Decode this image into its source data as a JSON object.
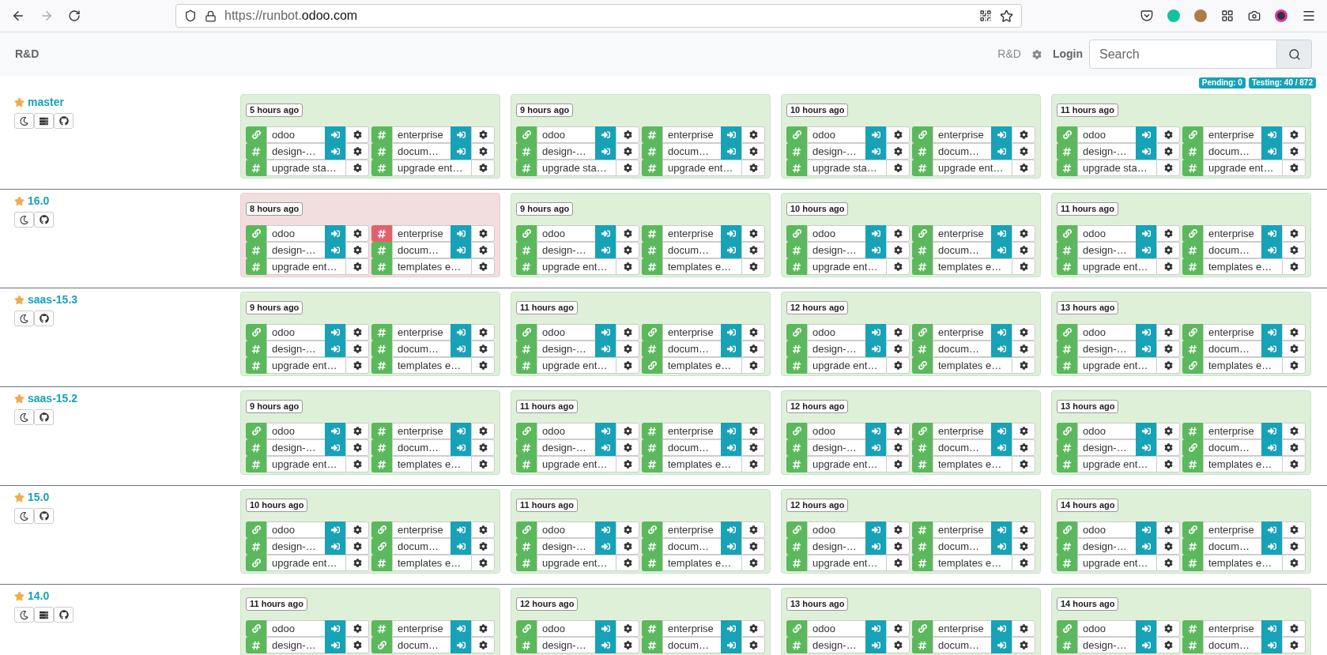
{
  "browser": {
    "url_prefix": "https://runbot.",
    "url_domain": "odoo.com",
    "forward_disabled": true
  },
  "navbar": {
    "brand": "R&D",
    "project": "R&D",
    "login": "Login",
    "search": {
      "placeholder": "Search"
    }
  },
  "status": [
    {
      "label": "Pending: 0"
    },
    {
      "label": "Testing: 40 / 872"
    }
  ],
  "bundles": [
    {
      "name": "master",
      "starred": true,
      "actions": [
        {
          "kind": "theme"
        },
        {
          "kind": "stats"
        },
        {
          "kind": "code"
        }
      ],
      "batches": [
        {
          "time": "5 hours ago",
          "failed": false,
          "columns": [
            [
              {
                "name": "odoo",
                "kind": "link",
                "failed": false,
                "login": true
              },
              {
                "name": "design-…",
                "kind": "hash",
                "failed": false,
                "login": true
              },
              {
                "name": "upgrade sta…",
                "kind": "hash",
                "failed": false,
                "login": false
              }
            ],
            [
              {
                "name": "enterprise",
                "kind": "hash",
                "failed": false,
                "login": true
              },
              {
                "name": "docum…",
                "kind": "hash",
                "failed": false,
                "login": true
              },
              {
                "name": "upgrade ent…",
                "kind": "hash",
                "failed": false,
                "login": false
              }
            ]
          ]
        },
        {
          "time": "9 hours ago",
          "failed": false,
          "columns": [
            [
              {
                "name": "odoo",
                "kind": "link",
                "failed": false,
                "login": true
              },
              {
                "name": "design-…",
                "kind": "hash",
                "failed": false,
                "login": true
              },
              {
                "name": "upgrade sta…",
                "kind": "hash",
                "failed": false,
                "login": false
              }
            ],
            [
              {
                "name": "enterprise",
                "kind": "hash",
                "failed": false,
                "login": true
              },
              {
                "name": "docum…",
                "kind": "hash",
                "failed": false,
                "login": true
              },
              {
                "name": "upgrade ent…",
                "kind": "hash",
                "failed": false,
                "login": false
              }
            ]
          ]
        },
        {
          "time": "10 hours ago",
          "failed": false,
          "columns": [
            [
              {
                "name": "odoo",
                "kind": "link",
                "failed": false,
                "login": true
              },
              {
                "name": "design-…",
                "kind": "hash",
                "failed": false,
                "login": true
              },
              {
                "name": "upgrade sta…",
                "kind": "hash",
                "failed": false,
                "login": false
              }
            ],
            [
              {
                "name": "enterprise",
                "kind": "link",
                "failed": false,
                "login": true
              },
              {
                "name": "docum…",
                "kind": "hash",
                "failed": false,
                "login": true
              },
              {
                "name": "upgrade ent…",
                "kind": "hash",
                "failed": false,
                "login": false
              }
            ]
          ]
        },
        {
          "time": "11 hours ago",
          "failed": false,
          "columns": [
            [
              {
                "name": "odoo",
                "kind": "link",
                "failed": false,
                "login": true
              },
              {
                "name": "design-…",
                "kind": "hash",
                "failed": false,
                "login": true
              },
              {
                "name": "upgrade sta…",
                "kind": "hash",
                "failed": false,
                "login": false
              }
            ],
            [
              {
                "name": "enterprise",
                "kind": "link",
                "failed": false,
                "login": true
              },
              {
                "name": "docum…",
                "kind": "hash",
                "failed": false,
                "login": true
              },
              {
                "name": "upgrade ent…",
                "kind": "hash",
                "failed": false,
                "login": false
              }
            ]
          ]
        }
      ]
    },
    {
      "name": "16.0",
      "starred": true,
      "actions": [
        {
          "kind": "theme"
        },
        {
          "kind": "code"
        }
      ],
      "batches": [
        {
          "time": "8 hours ago",
          "failed": true,
          "columns": [
            [
              {
                "name": "odoo",
                "kind": "link",
                "failed": false,
                "login": true
              },
              {
                "name": "design-…",
                "kind": "hash",
                "failed": false,
                "login": true
              },
              {
                "name": "upgrade ent…",
                "kind": "hash",
                "failed": false,
                "login": false
              }
            ],
            [
              {
                "name": "enterprise",
                "kind": "hash",
                "failed": true,
                "login": true
              },
              {
                "name": "docum…",
                "kind": "hash",
                "failed": false,
                "login": true
              },
              {
                "name": "templates e…",
                "kind": "hash",
                "failed": false,
                "login": false
              }
            ]
          ]
        },
        {
          "time": "9 hours ago",
          "failed": false,
          "columns": [
            [
              {
                "name": "odoo",
                "kind": "link",
                "failed": false,
                "login": true
              },
              {
                "name": "design-…",
                "kind": "hash",
                "failed": false,
                "login": true
              },
              {
                "name": "upgrade ent…",
                "kind": "hash",
                "failed": false,
                "login": false
              }
            ],
            [
              {
                "name": "enterprise",
                "kind": "hash",
                "failed": false,
                "login": true
              },
              {
                "name": "docum…",
                "kind": "hash",
                "failed": false,
                "login": true
              },
              {
                "name": "templates e…",
                "kind": "hash",
                "failed": false,
                "login": false
              }
            ]
          ]
        },
        {
          "time": "10 hours ago",
          "failed": false,
          "columns": [
            [
              {
                "name": "odoo",
                "kind": "link",
                "failed": false,
                "login": true
              },
              {
                "name": "design-…",
                "kind": "hash",
                "failed": false,
                "login": true
              },
              {
                "name": "upgrade ent…",
                "kind": "hash",
                "failed": false,
                "login": false
              }
            ],
            [
              {
                "name": "enterprise",
                "kind": "link",
                "failed": false,
                "login": true
              },
              {
                "name": "docum…",
                "kind": "hash",
                "failed": false,
                "login": true
              },
              {
                "name": "templates e…",
                "kind": "hash",
                "failed": false,
                "login": false
              }
            ]
          ]
        },
        {
          "time": "11 hours ago",
          "failed": false,
          "columns": [
            [
              {
                "name": "odoo",
                "kind": "link",
                "failed": false,
                "login": true
              },
              {
                "name": "design-…",
                "kind": "hash",
                "failed": false,
                "login": true
              },
              {
                "name": "upgrade ent…",
                "kind": "hash",
                "failed": false,
                "login": false
              }
            ],
            [
              {
                "name": "enterprise",
                "kind": "link",
                "failed": false,
                "login": true
              },
              {
                "name": "docum…",
                "kind": "hash",
                "failed": false,
                "login": true
              },
              {
                "name": "templates e…",
                "kind": "hash",
                "failed": false,
                "login": false
              }
            ]
          ]
        }
      ]
    },
    {
      "name": "saas-15.3",
      "starred": true,
      "actions": [
        {
          "kind": "theme"
        },
        {
          "kind": "code"
        }
      ],
      "batches": [
        {
          "time": "9 hours ago",
          "failed": false,
          "columns": [
            [
              {
                "name": "odoo",
                "kind": "link",
                "failed": false,
                "login": true
              },
              {
                "name": "design-…",
                "kind": "hash",
                "failed": false,
                "login": true
              },
              {
                "name": "upgrade ent…",
                "kind": "hash",
                "failed": false,
                "login": false
              }
            ],
            [
              {
                "name": "enterprise",
                "kind": "hash",
                "failed": false,
                "login": true
              },
              {
                "name": "docum…",
                "kind": "hash",
                "failed": false,
                "login": true
              },
              {
                "name": "templates e…",
                "kind": "hash",
                "failed": false,
                "login": false
              }
            ]
          ]
        },
        {
          "time": "11 hours ago",
          "failed": false,
          "columns": [
            [
              {
                "name": "odoo",
                "kind": "link",
                "failed": false,
                "login": true
              },
              {
                "name": "design-…",
                "kind": "hash",
                "failed": false,
                "login": true
              },
              {
                "name": "upgrade ent…",
                "kind": "hash",
                "failed": false,
                "login": false
              }
            ],
            [
              {
                "name": "enterprise",
                "kind": "link",
                "failed": false,
                "login": true
              },
              {
                "name": "docum…",
                "kind": "hash",
                "failed": false,
                "login": true
              },
              {
                "name": "templates e…",
                "kind": "link",
                "failed": false,
                "login": false
              }
            ]
          ]
        },
        {
          "time": "12 hours ago",
          "failed": false,
          "columns": [
            [
              {
                "name": "odoo",
                "kind": "link",
                "failed": false,
                "login": true
              },
              {
                "name": "design-…",
                "kind": "hash",
                "failed": false,
                "login": true
              },
              {
                "name": "upgrade ent…",
                "kind": "hash",
                "failed": false,
                "login": false
              }
            ],
            [
              {
                "name": "enterprise",
                "kind": "link",
                "failed": false,
                "login": true
              },
              {
                "name": "docum…",
                "kind": "hash",
                "failed": false,
                "login": true
              },
              {
                "name": "templates e…",
                "kind": "link",
                "failed": false,
                "login": false
              }
            ]
          ]
        },
        {
          "time": "13 hours ago",
          "failed": false,
          "columns": [
            [
              {
                "name": "odoo",
                "kind": "link",
                "failed": false,
                "login": true
              },
              {
                "name": "design-…",
                "kind": "hash",
                "failed": false,
                "login": true
              },
              {
                "name": "upgrade ent…",
                "kind": "hash",
                "failed": false,
                "login": false
              }
            ],
            [
              {
                "name": "enterprise",
                "kind": "link",
                "failed": false,
                "login": true
              },
              {
                "name": "docum…",
                "kind": "hash",
                "failed": false,
                "login": true
              },
              {
                "name": "templates e…",
                "kind": "link",
                "failed": false,
                "login": false
              }
            ]
          ]
        }
      ]
    },
    {
      "name": "saas-15.2",
      "starred": true,
      "actions": [
        {
          "kind": "theme"
        },
        {
          "kind": "code"
        }
      ],
      "batches": [
        {
          "time": "9 hours ago",
          "failed": false,
          "columns": [
            [
              {
                "name": "odoo",
                "kind": "link",
                "failed": false,
                "login": true
              },
              {
                "name": "design-…",
                "kind": "hash",
                "failed": false,
                "login": true
              },
              {
                "name": "upgrade ent…",
                "kind": "hash",
                "failed": false,
                "login": false
              }
            ],
            [
              {
                "name": "enterprise",
                "kind": "hash",
                "failed": false,
                "login": true
              },
              {
                "name": "docum…",
                "kind": "hash",
                "failed": false,
                "login": true
              },
              {
                "name": "templates e…",
                "kind": "hash",
                "failed": false,
                "login": false
              }
            ]
          ]
        },
        {
          "time": "11 hours ago",
          "failed": false,
          "columns": [
            [
              {
                "name": "odoo",
                "kind": "link",
                "failed": false,
                "login": true
              },
              {
                "name": "design-…",
                "kind": "hash",
                "failed": false,
                "login": true
              },
              {
                "name": "upgrade ent…",
                "kind": "hash",
                "failed": false,
                "login": false
              }
            ],
            [
              {
                "name": "enterprise",
                "kind": "hash",
                "failed": false,
                "login": true
              },
              {
                "name": "docum…",
                "kind": "hash",
                "failed": false,
                "login": true
              },
              {
                "name": "templates e…",
                "kind": "hash",
                "failed": false,
                "login": false
              }
            ]
          ]
        },
        {
          "time": "12 hours ago",
          "failed": false,
          "columns": [
            [
              {
                "name": "odoo",
                "kind": "link",
                "failed": false,
                "login": true
              },
              {
                "name": "design-…",
                "kind": "hash",
                "failed": false,
                "login": true
              },
              {
                "name": "upgrade ent…",
                "kind": "hash",
                "failed": false,
                "login": false
              }
            ],
            [
              {
                "name": "enterprise",
                "kind": "link",
                "failed": false,
                "login": true
              },
              {
                "name": "docum…",
                "kind": "hash",
                "failed": false,
                "login": true
              },
              {
                "name": "templates e…",
                "kind": "hash",
                "failed": false,
                "login": false
              }
            ]
          ]
        },
        {
          "time": "13 hours ago",
          "failed": false,
          "columns": [
            [
              {
                "name": "odoo",
                "kind": "link",
                "failed": false,
                "login": true
              },
              {
                "name": "design-…",
                "kind": "hash",
                "failed": false,
                "login": true
              },
              {
                "name": "upgrade ent…",
                "kind": "hash",
                "failed": false,
                "login": false
              }
            ],
            [
              {
                "name": "enterprise",
                "kind": "hash",
                "failed": false,
                "login": true
              },
              {
                "name": "docum…",
                "kind": "link",
                "failed": false,
                "login": true
              },
              {
                "name": "templates e…",
                "kind": "hash",
                "failed": false,
                "login": false
              }
            ]
          ]
        }
      ]
    },
    {
      "name": "15.0",
      "starred": true,
      "actions": [
        {
          "kind": "theme"
        },
        {
          "kind": "code"
        }
      ],
      "batches": [
        {
          "time": "10 hours ago",
          "failed": false,
          "columns": [
            [
              {
                "name": "odoo",
                "kind": "link",
                "failed": false,
                "login": true
              },
              {
                "name": "design-…",
                "kind": "hash",
                "failed": false,
                "login": true
              },
              {
                "name": "upgrade ent…",
                "kind": "link",
                "failed": false,
                "login": false
              }
            ],
            [
              {
                "name": "enterprise",
                "kind": "link",
                "failed": false,
                "login": true
              },
              {
                "name": "docum…",
                "kind": "link",
                "failed": false,
                "login": true
              },
              {
                "name": "templates e…",
                "kind": "hash",
                "failed": false,
                "login": false
              }
            ]
          ]
        },
        {
          "time": "11 hours ago",
          "failed": false,
          "columns": [
            [
              {
                "name": "odoo",
                "kind": "link",
                "failed": false,
                "login": true
              },
              {
                "name": "design-…",
                "kind": "hash",
                "failed": false,
                "login": true
              },
              {
                "name": "upgrade ent…",
                "kind": "hash",
                "failed": false,
                "login": false
              }
            ],
            [
              {
                "name": "enterprise",
                "kind": "link",
                "failed": false,
                "login": true
              },
              {
                "name": "docum…",
                "kind": "hash",
                "failed": false,
                "login": true
              },
              {
                "name": "templates e…",
                "kind": "hash",
                "failed": false,
                "login": false
              }
            ]
          ]
        },
        {
          "time": "12 hours ago",
          "failed": false,
          "columns": [
            [
              {
                "name": "odoo",
                "kind": "link",
                "failed": false,
                "login": true
              },
              {
                "name": "design-…",
                "kind": "hash",
                "failed": false,
                "login": true
              },
              {
                "name": "upgrade ent…",
                "kind": "hash",
                "failed": false,
                "login": false
              }
            ],
            [
              {
                "name": "enterprise",
                "kind": "hash",
                "failed": false,
                "login": true
              },
              {
                "name": "docum…",
                "kind": "hash",
                "failed": false,
                "login": true
              },
              {
                "name": "templates e…",
                "kind": "hash",
                "failed": false,
                "login": false
              }
            ]
          ]
        },
        {
          "time": "14 hours ago",
          "failed": false,
          "columns": [
            [
              {
                "name": "odoo",
                "kind": "link",
                "failed": false,
                "login": true
              },
              {
                "name": "design-…",
                "kind": "hash",
                "failed": false,
                "login": true
              },
              {
                "name": "upgrade ent…",
                "kind": "hash",
                "failed": false,
                "login": false
              }
            ],
            [
              {
                "name": "enterprise",
                "kind": "link",
                "failed": false,
                "login": true
              },
              {
                "name": "docum…",
                "kind": "hash",
                "failed": false,
                "login": true
              },
              {
                "name": "templates e…",
                "kind": "hash",
                "failed": false,
                "login": false
              }
            ]
          ]
        }
      ]
    },
    {
      "name": "14.0",
      "starred": true,
      "actions": [
        {
          "kind": "theme"
        },
        {
          "kind": "stats"
        },
        {
          "kind": "code"
        }
      ],
      "batches": [
        {
          "time": "11 hours ago",
          "failed": false,
          "columns": [
            [
              {
                "name": "odoo",
                "kind": "link",
                "failed": false,
                "login": true
              },
              {
                "name": "design-…",
                "kind": "hash",
                "failed": false,
                "login": true
              }
            ],
            [
              {
                "name": "enterprise",
                "kind": "hash",
                "failed": false,
                "login": true
              },
              {
                "name": "docum…",
                "kind": "link",
                "failed": false,
                "login": true
              }
            ]
          ]
        },
        {
          "time": "12 hours ago",
          "failed": false,
          "columns": [
            [
              {
                "name": "odoo",
                "kind": "link",
                "failed": false,
                "login": true
              },
              {
                "name": "design-…",
                "kind": "hash",
                "failed": false,
                "login": true
              }
            ],
            [
              {
                "name": "enterprise",
                "kind": "hash",
                "failed": false,
                "login": true
              },
              {
                "name": "docum…",
                "kind": "hash",
                "failed": false,
                "login": true
              }
            ]
          ]
        },
        {
          "time": "13 hours ago",
          "failed": false,
          "columns": [
            [
              {
                "name": "odoo",
                "kind": "link",
                "failed": false,
                "login": true
              },
              {
                "name": "design-…",
                "kind": "hash",
                "failed": false,
                "login": true
              }
            ],
            [
              {
                "name": "enterprise",
                "kind": "link",
                "failed": false,
                "login": true
              },
              {
                "name": "docum…",
                "kind": "hash",
                "failed": false,
                "login": true
              }
            ]
          ]
        },
        {
          "time": "14 hours ago",
          "failed": false,
          "columns": [
            [
              {
                "name": "odoo",
                "kind": "link",
                "failed": false,
                "login": true
              },
              {
                "name": "design-…",
                "kind": "hash",
                "failed": false,
                "login": true
              }
            ],
            [
              {
                "name": "enterprise",
                "kind": "hash",
                "failed": false,
                "login": true
              },
              {
                "name": "docum…",
                "kind": "hash",
                "failed": false,
                "login": true
              }
            ]
          ]
        }
      ]
    }
  ]
}
